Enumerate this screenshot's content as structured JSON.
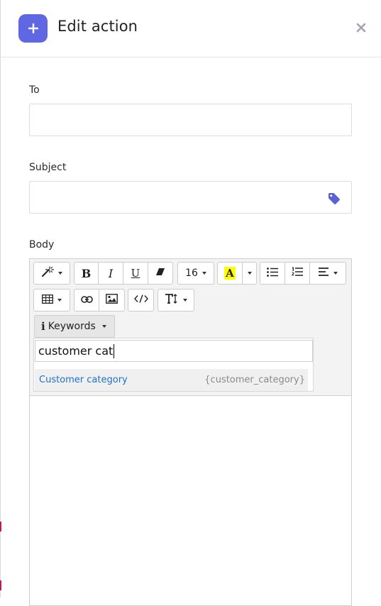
{
  "dialog": {
    "title": "Edit action",
    "header_icon": "plus-icon",
    "close_icon": "close-icon",
    "accent_color": "#6067e2"
  },
  "form": {
    "to": {
      "label": "To",
      "value": ""
    },
    "subject": {
      "label": "Subject",
      "value": "",
      "icon": "tag-icon"
    },
    "body": {
      "label": "Body"
    }
  },
  "toolbar": {
    "font_size": "16",
    "keywords_label": "Keywords",
    "buttons": [
      "magic-wand-icon",
      "bold-icon",
      "italic-icon",
      "underline-icon",
      "eraser-icon",
      "font-size-select",
      "text-color-icon",
      "unordered-list-icon",
      "ordered-list-icon",
      "align-icon",
      "table-icon",
      "link-icon",
      "image-icon",
      "code-view-icon",
      "text-height-icon",
      "info-icon"
    ]
  },
  "keywords_dropdown": {
    "search_value": "customer cat",
    "results": [
      {
        "name": "Customer category",
        "code": "{customer_category}"
      }
    ]
  }
}
